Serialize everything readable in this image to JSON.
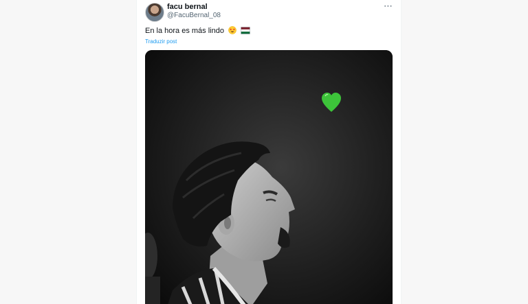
{
  "user": {
    "name": "facu bernal",
    "handle": "@FacuBernal_08"
  },
  "post": {
    "text": "En la hora es más lindo",
    "translate_label": "Traduzir post"
  },
  "icons": {
    "more": "more-options-icon",
    "emoji_face": "star-struck-emoji",
    "emoji_flag": "tricolor-flag-emoji",
    "media_heart": "green-heart-icon"
  },
  "colors": {
    "link": "#1d9bf0",
    "text": "#0f1419",
    "secondary": "#536471",
    "heart": "#3dc43a"
  }
}
